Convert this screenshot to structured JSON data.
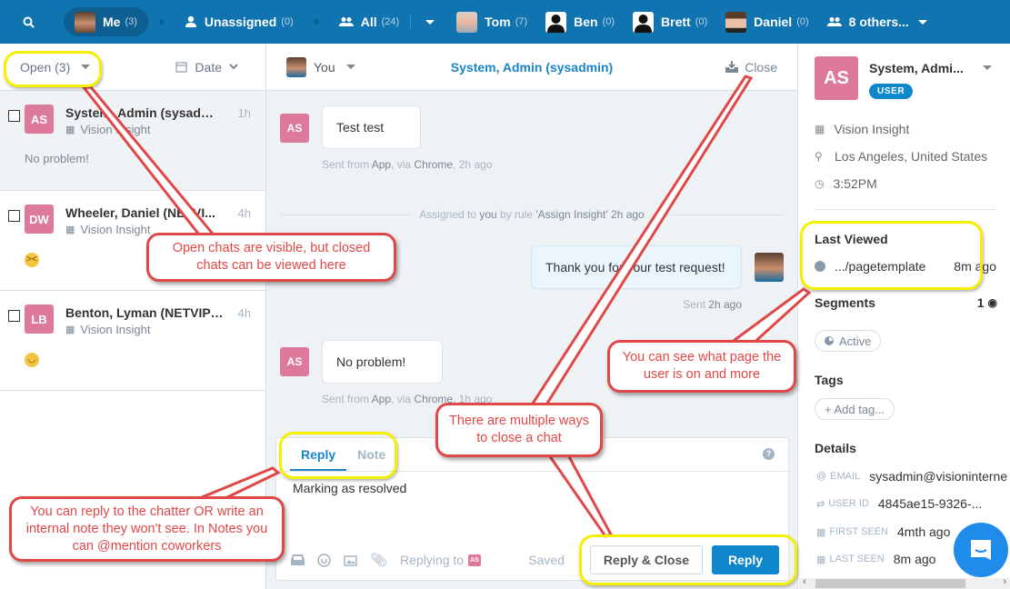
{
  "topbar": {
    "search_icon": "search-icon",
    "filters": [
      {
        "label": "Me",
        "count": "(3)",
        "avatar": "photo"
      },
      {
        "label": "Unassigned",
        "count": "(0)",
        "icon": "person-icon"
      },
      {
        "label": "All",
        "count": "(24)",
        "icon": "people-icon"
      },
      {
        "label": "Tom",
        "count": "(7)",
        "avatar": "photo"
      },
      {
        "label": "Ben",
        "count": "(0)",
        "avatar": "silhouette"
      },
      {
        "label": "Brett",
        "count": "(0)",
        "avatar": "silhouette"
      },
      {
        "label": "Daniel",
        "count": "(0)",
        "avatar": "photo"
      },
      {
        "label": "8 others...",
        "icon": "people-icon"
      }
    ]
  },
  "inbox": {
    "status_filter": "Open (3)",
    "sort_label": "Date",
    "conversations": [
      {
        "initials": "AS",
        "name": "System, Admin (sysadmin)",
        "time": "1h",
        "company": "Vision Insight",
        "preview": "No problem!",
        "active": true
      },
      {
        "initials": "DW",
        "name": "Wheeler, Daniel (NETVI...",
        "time": "4h",
        "company": "Vision Insight",
        "preview_emoji": "tired-face"
      },
      {
        "initials": "LB",
        "name": "Benton, Lyman (NETVIP ...",
        "time": "4h",
        "company": "Vision Insight",
        "preview_emoji": "smiley"
      }
    ]
  },
  "conversation": {
    "assignee": "You",
    "title": "System, Admin (sysadmin)",
    "close_label": "Close",
    "messages": [
      {
        "from": "AS",
        "text": "Test test",
        "meta_pre": "Sent from ",
        "meta_app": "App",
        "meta_via": ", via ",
        "meta_browser": "Chrome",
        "meta_time": ", 2h ago"
      },
      {
        "from": "me",
        "text": "Thank you for your test request!",
        "meta_pre": "Sent ",
        "meta_time": "2h ago"
      },
      {
        "from": "AS",
        "text": "No problem!",
        "meta_pre": "Sent from ",
        "meta_app": "App",
        "meta_via": ", via ",
        "meta_browser": "Chrome",
        "meta_time": ", 1h ago"
      }
    ],
    "system_event": {
      "pre": "Assigned to ",
      "who": "you",
      "mid": " by rule ",
      "rule": "'Assign Insight' 2h ago"
    }
  },
  "composer": {
    "tabs": [
      "Reply",
      "Note"
    ],
    "active_tab": "Reply",
    "text": "Marking as resolved",
    "replying_to_label": "Replying to",
    "replying_to_initials": "AS",
    "saved_label": "Saved",
    "reply_close_label": "Reply & Close",
    "reply_label": "Reply",
    "help": "?"
  },
  "profile": {
    "initials": "AS",
    "name": "System, Admi...",
    "badge": "USER",
    "company": "Vision Insight",
    "location": "Los Angeles, United States",
    "local_time": "3:52PM",
    "last_viewed_heading": "Last Viewed",
    "last_viewed_page": ".../pagetemplate",
    "last_viewed_time": "8m ago",
    "segments_heading": "Segments",
    "segments_count": "1",
    "segment": "Active",
    "tags_heading": "Tags",
    "add_tag": "+ Add tag...",
    "details_heading": "Details",
    "details": [
      {
        "label": "EMAIL",
        "value": "sysadmin@visioninterne"
      },
      {
        "label": "USER ID",
        "value": "4845ae15-9326-..."
      },
      {
        "label": "FIRST SEEN",
        "value": "4mth ago"
      },
      {
        "label": "LAST SEEN",
        "value": "8m ago"
      }
    ]
  },
  "annotations": [
    "Open chats are visible, but closed chats can be viewed here",
    "You can see what page the user is on and more",
    "There are multiple ways to close a chat",
    "You can reply to the chatter OR write an internal note they won't see. In Notes you can @mention coworkers"
  ],
  "colors": {
    "brand": "#1074b0",
    "accent": "#0e87cc",
    "avatar": "#dd7a9a",
    "annotation": "#e04848",
    "highlight": "#f4f000"
  }
}
